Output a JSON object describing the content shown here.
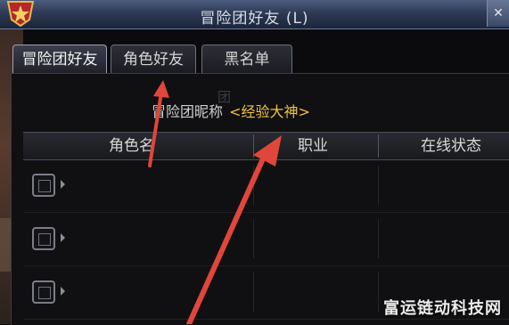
{
  "window": {
    "title": "冒险团好友 (L)",
    "close_label": "✕"
  },
  "tabs": [
    {
      "label": "冒险团好友",
      "active": true
    },
    {
      "label": "角色好友",
      "active": false
    },
    {
      "label": "黑名单",
      "active": false
    }
  ],
  "nickname": {
    "label": "冒险团昵称",
    "value": "<经验大神>"
  },
  "columns": [
    "角色名",
    "职业",
    "在线状态"
  ],
  "rows": [
    {
      "checked": false
    },
    {
      "checked": false
    },
    {
      "checked": false
    }
  ],
  "faint_label": "团",
  "colors": {
    "accent_name": "#f0c23c",
    "annotation_arrow": "#e0463a"
  },
  "watermark": "富运链动科技网"
}
